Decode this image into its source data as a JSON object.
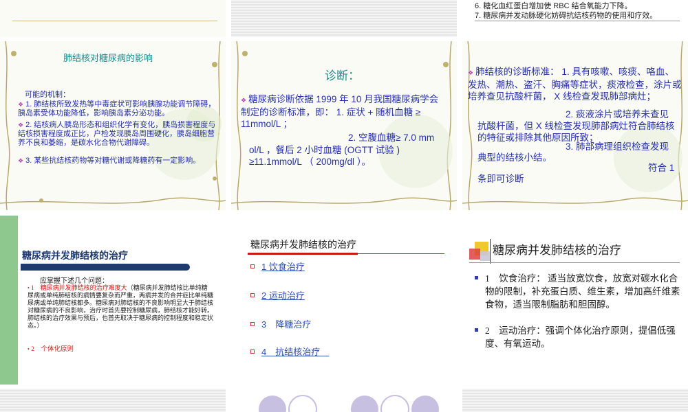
{
  "top_right": {
    "line6": "6. 糖化血红蛋白增加使 RBC 结合氧能力下降。",
    "line7": "7. 糖尿病并发动脉硬化妨碍抗结核药物的使用和疗效。"
  },
  "slide_tb_effect": {
    "title": "肺结核对糖尿病的影响",
    "intro": "可能的机制：",
    "items": [
      "1. 肺结核所致发热等中毒症状可影响胰腺功能调节障碍，胰岛素受体功能降低，影响胰岛素分泌功能。",
      "2. 结核病人胰岛形态和组织化学有变化，胰岛损害程度与结核损害程度成正比，户检发现胰岛周围硬化，胰岛细胞营养不良和萎缩，是碳水化合物代谢障碍。",
      "3. 某些抗结核药物等对糖代谢或降糖药有一定影响。"
    ]
  },
  "slide_diagnosis": {
    "title": "诊断：",
    "para1": "糖尿病诊断依据 1999 年 10 月我国糖尿病学会制定的诊断标准，即： 1. 症状 + 随机血糖 ≥ 11mmol/L ；",
    "para2_right": "2. 空腹血糖≥ 7.0 mm",
    "para2": "ol/L ，餐后 2 小时血糖 (OGTT 试验 ) ≥11.1mmol/L （ 200mg/dl ）。"
  },
  "slide_tb_criteria": {
    "c1": "肺结核的诊断标准： 1. 具有咳嗽、咳痰、咯血、发热、潮热、盗汗、胸痛等症状，痰液检查，涂片或培养查见抗酸杆菌， X 线检查发现肺部病灶；",
    "c2_right": "2. 痰液涂片或培养未查见",
    "c2": "抗酸杆菌，但 X 线检查发现肺部病灶符合肺结核的特征或排除其他原因所致；",
    "c3_right": "3. 肺部病理组织检查发现",
    "c3": "典型的结核小结。",
    "c4_right": "符合 1",
    "c4": "条即可诊断"
  },
  "slide_treatment_intro": {
    "title": "糖尿病并发肺结核的治疗",
    "lead": "应掌握下述几个问题：",
    "item1_red": "1　糖尿病并发肺结核的治疗难度大",
    "item1_rest": "（糖尿病并发肺结核比单纯糖尿病或单纯肺结核的病情要复杂而严重，两病并发的合并症比单纯糖尿病或单纯肺结核都多。糖尿病对肺结核的不良影响明显大于肺结核对糖尿病的不良影响，治疗时首先要控制糖尿病，肺结核才能好转。肺结核的治疗效果与预后，也首先取决于糖尿病的控制程度和稳定状态。）",
    "item2": "2　个体化原则"
  },
  "slide_treatment_menu": {
    "title": "糖尿病并发肺结核的治疗",
    "items": [
      "1  饮食治疗",
      "2  运动治疗",
      "3　降糖治疗",
      "4　抗结核治疗　"
    ]
  },
  "slide_treatment_detail": {
    "title": "糖尿病并发肺结核的治疗",
    "item1": "1　饮食治疗： 适当放宽饮食，放宽对碳水化合物的限制，补充蛋白质、维生素，增加高纤维素食物，适当限制脂肪和胆固醇。",
    "item2": "2　运动治疗：强调个体化治疗原则，提倡低强度、有氧运动。"
  },
  "colors": {
    "text_blue": "#2530a8",
    "title_teal": "#1a8a8a",
    "accent_red": "#d01818",
    "bar_navy": "#1e3a6e",
    "sidebar_green": "#8fc88f"
  }
}
